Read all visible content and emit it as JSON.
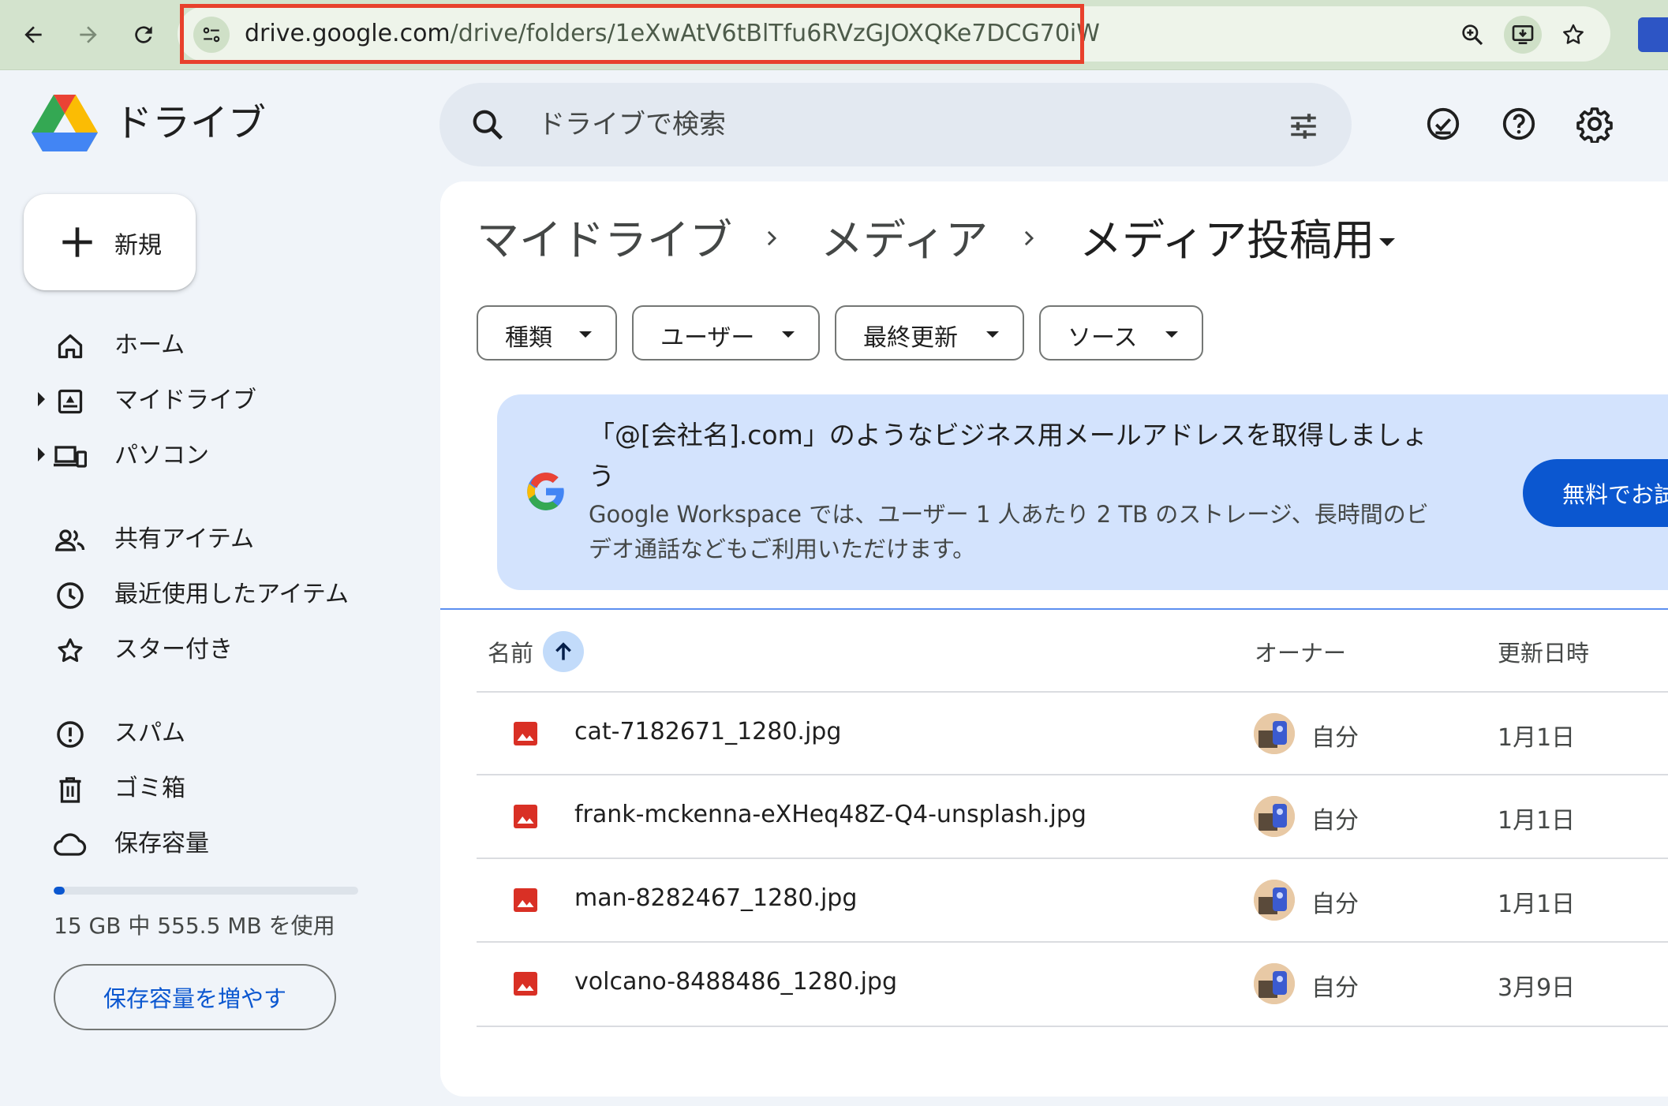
{
  "browser": {
    "url_host": "drive.google.com",
    "url_path": "/drive/folders/1eXwAtV6tBlTfu6RVzGJOXQKe7DCG70iW"
  },
  "app": {
    "name": "ドライブ"
  },
  "search": {
    "placeholder": "ドライブで検索"
  },
  "sidebar": {
    "new_label": "新規",
    "items": [
      {
        "label": "ホーム",
        "icon": "home-icon"
      },
      {
        "label": "マイドライブ",
        "icon": "my-drive-icon"
      },
      {
        "label": "パソコン",
        "icon": "computers-icon"
      },
      {
        "label": "共有アイテム",
        "icon": "shared-icon"
      },
      {
        "label": "最近使用したアイテム",
        "icon": "recent-icon"
      },
      {
        "label": "スター付き",
        "icon": "star-icon"
      },
      {
        "label": "スパム",
        "icon": "spam-icon"
      },
      {
        "label": "ゴミ箱",
        "icon": "trash-icon"
      },
      {
        "label": "保存容量",
        "icon": "cloud-icon"
      }
    ],
    "storage_used_fraction": 0.037,
    "storage_text": "15 GB 中 555.5 MB を使用",
    "more_storage_label": "保存容量を増やす"
  },
  "breadcrumb": [
    "マイドライブ",
    "メディア",
    "メディア投稿用"
  ],
  "filters": [
    "種類",
    "ユーザー",
    "最終更新",
    "ソース"
  ],
  "banner": {
    "title": "「@[会社名].com」のようなビジネス用メールアドレスを取得しましょう",
    "body": "Google Workspace では、ユーザー 1 人あたり 2 TB のストレージ、長時間のビデオ通話などもご利用いただけます。",
    "button_label": "無料でお試し"
  },
  "table": {
    "columns": [
      "名前",
      "オーナー",
      "更新日時"
    ],
    "rows": [
      {
        "name": "cat-7182671_1280.jpg",
        "owner": "自分",
        "modified": "1月1日"
      },
      {
        "name": "frank-mckenna-eXHeq48Z-Q4-unsplash.jpg",
        "owner": "自分",
        "modified": "1月1日"
      },
      {
        "name": "man-8282467_1280.jpg",
        "owner": "自分",
        "modified": "1月1日"
      },
      {
        "name": "volcano-8488486_1280.jpg",
        "owner": "自分",
        "modified": "3月9日"
      }
    ]
  },
  "colors": {
    "accent": "#0b57d0",
    "image_file": "#d93025",
    "url_highlight": "#e8412c"
  }
}
